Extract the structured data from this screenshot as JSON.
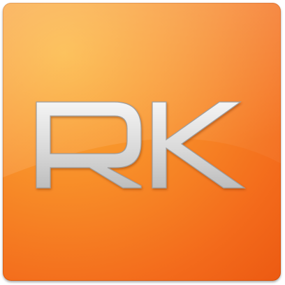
{
  "icon": {
    "monogram": "RK",
    "colors": {
      "orange_light": "#fbb234",
      "orange_mid": "#f8912a",
      "orange_dark": "#ec5a12",
      "letter_fill": "#dcdcdc",
      "letter_stroke": "#a9a9a9"
    }
  }
}
